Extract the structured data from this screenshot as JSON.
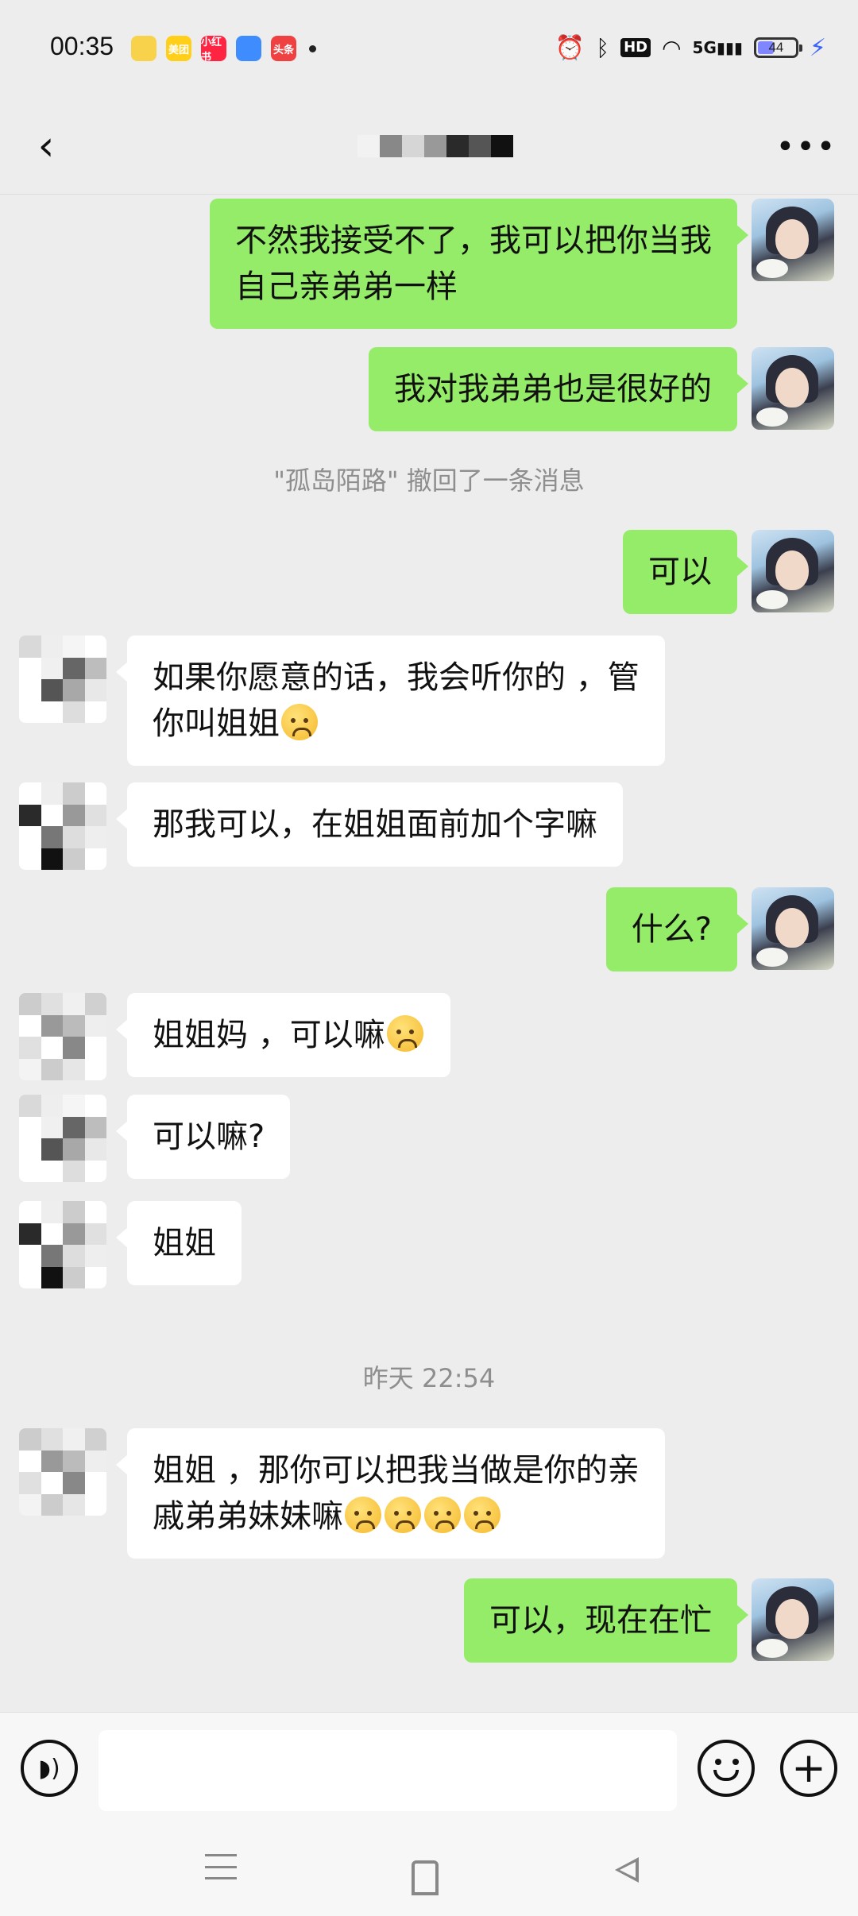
{
  "status_bar": {
    "time": "00:35",
    "app_icons": [
      {
        "name": "bunny-app-icon",
        "label": "",
        "color": "#f7d24a"
      },
      {
        "name": "meituan-app-icon",
        "label": "美团",
        "color": "#ffcf1a"
      },
      {
        "name": "xiaohongshu-app-icon",
        "label": "小红书",
        "color": "#ff2442"
      },
      {
        "name": "blue-app-icon",
        "label": "",
        "color": "#3f8cff"
      },
      {
        "name": "toutiao-app-icon",
        "label": "头条",
        "color": "#f04142"
      }
    ],
    "hd_label": "HD",
    "network_label": "5G",
    "battery_level": "44",
    "battery_fraction": 0.44
  },
  "header": {
    "back_icon": "chevron-left-icon",
    "more_icon": "more-dots-icon",
    "title_mosaic_colors": [
      "#f2f2f2",
      "#888888",
      "#d6d6d6",
      "#999999",
      "#2a2a2a",
      "#555555",
      "#111111"
    ]
  },
  "messages": [
    {
      "side": "me",
      "lines": [
        "不然我接受不了，我可以把你当我",
        "自己亲弟弟一样"
      ],
      "emoji_count": 0
    },
    {
      "side": "me",
      "lines": [
        "我对我弟弟也是很好的"
      ],
      "emoji_count": 0
    },
    {
      "type": "notice",
      "text": "\"孤岛陌路\" 撤回了一条消息"
    },
    {
      "side": "me",
      "lines": [
        "可以"
      ],
      "emoji_count": 0
    },
    {
      "side": "other",
      "lines": [
        "如果你愿意的话，我会听你的 ，管",
        "你叫姐姐"
      ],
      "emoji_count": 1
    },
    {
      "side": "other",
      "lines": [
        "那我可以，在姐姐面前加个字嘛"
      ],
      "emoji_count": 0
    },
    {
      "side": "me",
      "lines": [
        "什么?"
      ],
      "emoji_count": 0
    },
    {
      "side": "other",
      "lines": [
        "姐姐妈 ，可以嘛"
      ],
      "emoji_count": 1
    },
    {
      "side": "other",
      "lines": [
        "可以嘛?"
      ],
      "emoji_count": 0
    },
    {
      "side": "other",
      "lines": [
        "姐姐"
      ],
      "emoji_count": 0
    },
    {
      "type": "notice",
      "text": "昨天 22:54"
    },
    {
      "side": "other",
      "lines": [
        "姐姐 ，那你可以把我当做是你的亲",
        "戚弟弟妹妹嘛"
      ],
      "emoji_count": 4
    },
    {
      "side": "me",
      "lines": [
        "可以，现在在忙"
      ],
      "emoji_count": 0
    }
  ],
  "input_bar": {
    "voice_icon": "voice-icon",
    "input_value": "",
    "emoji_icon": "emoji-icon",
    "plus_icon": "plus-icon",
    "plus_glyph": "+"
  },
  "nav_bar": {
    "menu_icon": "menu-icon",
    "home_icon": "home-icon",
    "back_icon": "back-triangle-icon"
  }
}
